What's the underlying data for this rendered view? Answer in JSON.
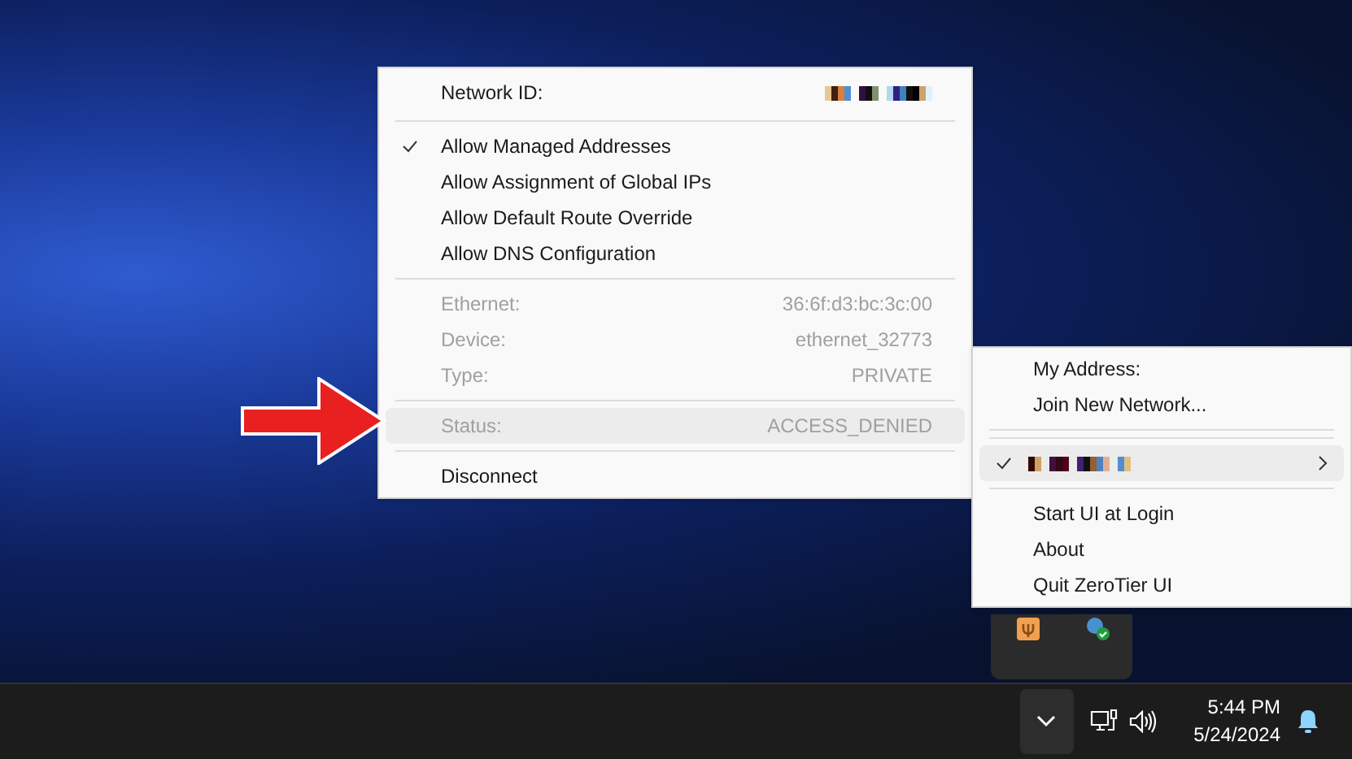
{
  "network_menu": {
    "network_id_label": "Network ID:",
    "options": [
      {
        "label": "Allow Managed Addresses",
        "checked": true
      },
      {
        "label": "Allow Assignment of Global IPs",
        "checked": false
      },
      {
        "label": "Allow Default Route Override",
        "checked": false
      },
      {
        "label": "Allow DNS Configuration",
        "checked": false
      }
    ],
    "details": [
      {
        "label": "Ethernet:",
        "value": "36:6f:d3:bc:3c:00",
        "disabled": true
      },
      {
        "label": "Device:",
        "value": "ethernet_32773",
        "disabled": true
      },
      {
        "label": "Type:",
        "value": "PRIVATE",
        "disabled": true
      }
    ],
    "status": {
      "label": "Status:",
      "value": "ACCESS_DENIED",
      "disabled": true,
      "highlighted": true
    },
    "disconnect": "Disconnect"
  },
  "main_menu": {
    "top": [
      {
        "label": "My Address:"
      },
      {
        "label": "Join New Network..."
      }
    ],
    "network": {
      "checked": true,
      "highlighted": true
    },
    "bottom": [
      {
        "label": "Start UI at Login"
      },
      {
        "label": "About"
      },
      {
        "label": "Quit ZeroTier UI"
      }
    ]
  },
  "taskbar": {
    "time": "5:44 PM",
    "date": "5/24/2024"
  }
}
